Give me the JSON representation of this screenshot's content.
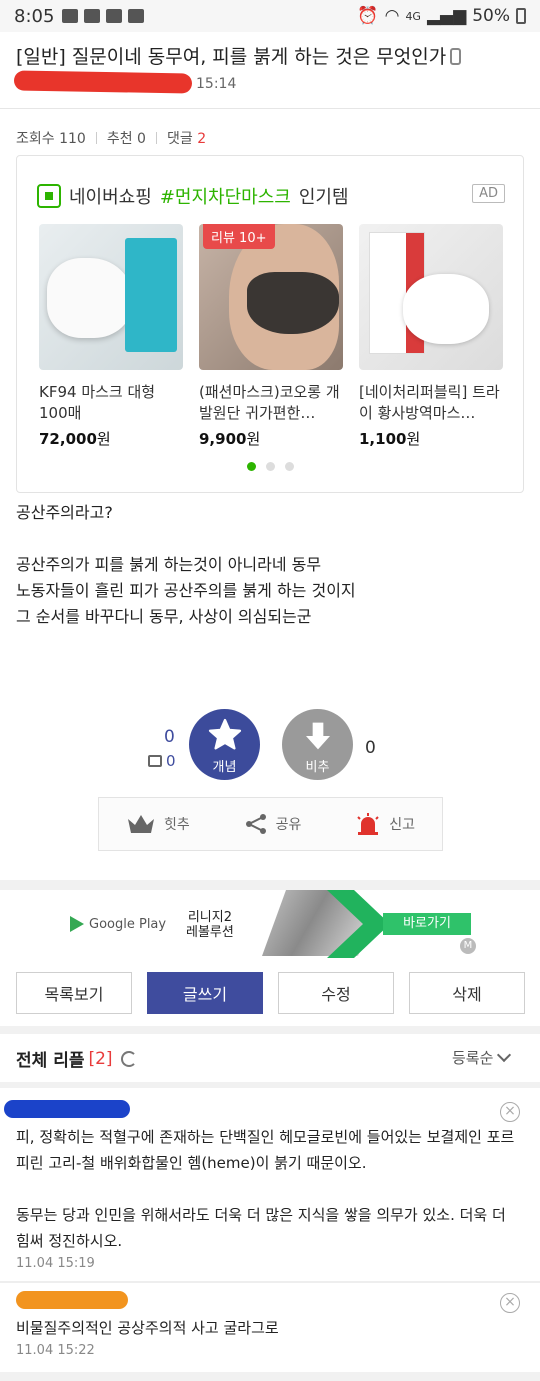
{
  "status_bar": {
    "time": "8:05",
    "network": "4G",
    "battery": "50%"
  },
  "post": {
    "title": "[일반] 질문이네 동무여, 피를 붉게 하는 것은 무엇인가",
    "time": "15:14",
    "views_label": "조회수",
    "views": "110",
    "recommend_label": "추천",
    "recommend": "0",
    "comments_label": "댓글",
    "comments": "2",
    "body_lines": [
      "공산주의라고?",
      "",
      "공산주의가 피를 붉게 하는것이 아니라네 동무",
      "노동자들이 흘린 피가 공산주의를 붉게 하는 것이지",
      "그 순서를 바꾸다니 동무, 사상이 의심되는군"
    ]
  },
  "ad": {
    "brand": "네이버쇼핑",
    "hashtag": "#먼지차단마스크",
    "suffix": "인기템",
    "tag": "AD",
    "products": [
      {
        "name": "KF94 마스크 대형 100매",
        "price": "72,000",
        "unit": "원",
        "badge": ""
      },
      {
        "name": "(패션마스크)코오롱 개발원단 귀가편한…",
        "price": "9,900",
        "unit": "원",
        "badge": "리뷰 10+"
      },
      {
        "name": "[네이처리퍼블릭] 트라이 황사방역마스…",
        "price": "1,100",
        "unit": "원",
        "badge": ""
      }
    ]
  },
  "votes": {
    "up_count": "0",
    "up_sub": "0",
    "up_label": "개념",
    "down_label": "비추",
    "down_count": "0"
  },
  "actions": {
    "hot": "힛추",
    "share": "공유",
    "report": "신고"
  },
  "banner": {
    "store": "Google Play",
    "game_line1": "리니지2",
    "game_line2": "레볼루션",
    "cta": "바로가기",
    "mark": "M"
  },
  "buttons": {
    "list": "목록보기",
    "write": "글쓰기",
    "edit": "수정",
    "delete": "삭제"
  },
  "comments_section": {
    "title": "전체 리플",
    "count": "[2]",
    "sort": "등록순",
    "items": [
      {
        "text": "피, 정확히는 적혈구에 존재하는 단백질인 헤모글로빈에 들어있는 보결제인 포르피린 고리-철 배위화합물인 헴(heme)이 붉기 때문이오.\n\n동무는 당과 인민을 위해서라도 더욱 더 많은 지식을 쌓을 의무가 있소. 더욱 더 힘써 정진하시오.",
        "time": "11.04 15:19"
      },
      {
        "text": "비물질주의적인 공상주의적 사고 굴라그로",
        "time": "11.04 15:22"
      }
    ]
  },
  "colors": {
    "accent": "#3f4c9e",
    "naver_green": "#2db400",
    "count_red": "#e83b3b"
  }
}
